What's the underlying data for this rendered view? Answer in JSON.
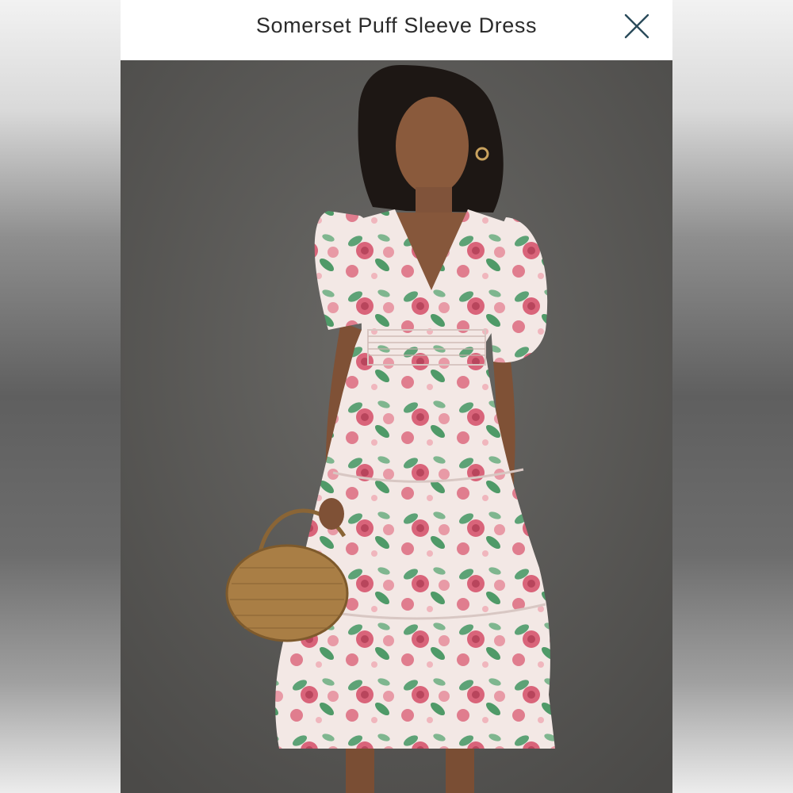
{
  "header": {
    "title": "Somerset Puff Sleeve Dress",
    "close_icon": "close-icon"
  },
  "photo": {
    "icon": "product-photo",
    "backdrop_color": "#5c5b59",
    "dress_color": "#f2e6e3",
    "flower_color": "#d9647a",
    "leaf_color": "#4f9a68",
    "bag_color": "#a97e45"
  }
}
